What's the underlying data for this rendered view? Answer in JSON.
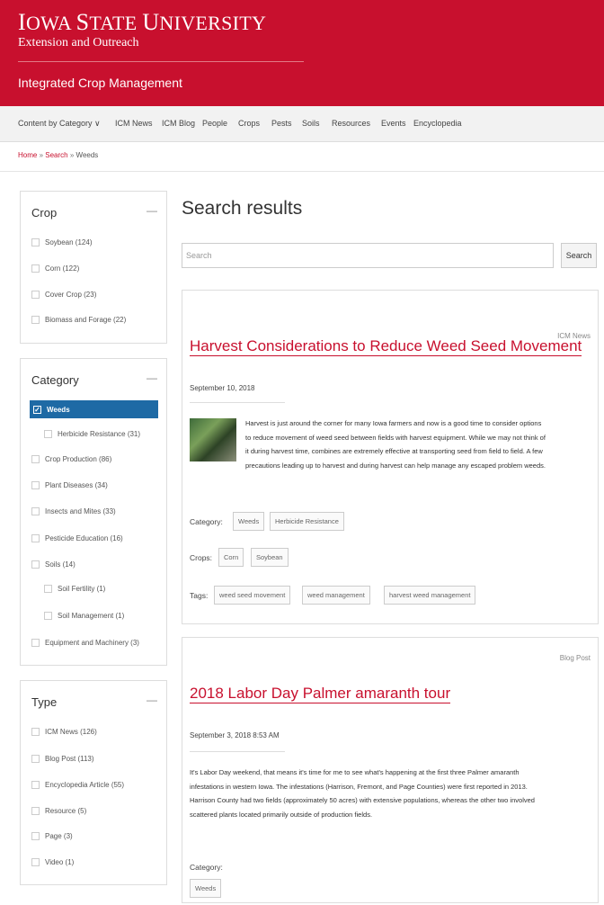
{
  "header": {
    "university_first": "I",
    "university_rest": "OWA ",
    "university_first2": "S",
    "university_rest2": "TATE ",
    "university_first3": "U",
    "university_rest3": "NIVERSITY",
    "subtitle": "Extension and Outreach",
    "unit": "Integrated Crop Management"
  },
  "nav": {
    "items": [
      "Content by Category ∨",
      "ICM News",
      "ICM Blog",
      "People",
      "Crops",
      "Pests",
      "Soils",
      "Resources",
      "Events",
      "Encyclopedia"
    ]
  },
  "breadcrumb": {
    "home": "Home",
    "sep": "»",
    "search": "Search",
    "current": "Weeds"
  },
  "facets": {
    "crop": {
      "title": "Crop",
      "toggle": "—",
      "options": [
        "Soybean (124)",
        "Corn (122)",
        "Cover Crop (23)",
        "Biomass and Forage (22)"
      ]
    },
    "category": {
      "title": "Category",
      "toggle": "—",
      "active": "Weeds",
      "options": [
        "Herbicide Resistance (31)",
        "Crop Production (86)",
        "Plant Diseases (34)",
        "Insects and Mites (33)",
        "Pesticide Education (16)",
        "Soils (14)",
        "Soil Fertility (1)",
        "Soil Management (1)",
        "Equipment and Machinery (3)"
      ]
    },
    "type": {
      "title": "Type",
      "toggle": "—",
      "options": [
        "ICM News (126)",
        "Blog Post (113)",
        "Encyclopedia Article (55)",
        "Resource (5)",
        "Page (3)",
        "Video (1)"
      ]
    }
  },
  "main": {
    "title": "Search results",
    "search_placeholder": "Search",
    "search_button": "Search"
  },
  "results": [
    {
      "type": "ICM News",
      "title": "Harvest Considerations to Reduce Weed Seed Movement",
      "date": "September 10, 2018",
      "summary_lines": [
        "Harvest is just around the corner for many Iowa farmers and now is a good time to consider options",
        "to reduce movement of weed seed between fields with harvest equipment. While we may not think of",
        "it during harvest time, combines are extremely effective at transporting seed from field to field. A few",
        "precautions leading up to harvest and during harvest can help manage any escaped problem weeds."
      ],
      "category_label": "Category:",
      "categories": [
        "Weeds",
        "Herbicide Resistance"
      ],
      "crops_label": "Crops:",
      "crops": [
        "Corn",
        "Soybean"
      ],
      "tags_label": "Tags:",
      "tags": [
        "weed seed movement",
        "weed management",
        "harvest weed management"
      ]
    },
    {
      "type": "Blog Post",
      "title": "2018 Labor Day Palmer amaranth tour",
      "date": "September 3, 2018 8:53 AM",
      "summary_lines": [
        "It's Labor Day weekend, that means it's time for me to see what's happening at the first three Palmer amaranth",
        "infestations in western Iowa. The infestations (Harrison, Fremont, and Page Counties) were first reported in 2013.",
        " Harrison County had two fields (approximately 50 acres) with extensive populations, whereas the other two involved",
        "scattered plants located primarily outside of production fields."
      ],
      "category_label": "Category:",
      "categories": [
        "Weeds"
      ]
    }
  ]
}
